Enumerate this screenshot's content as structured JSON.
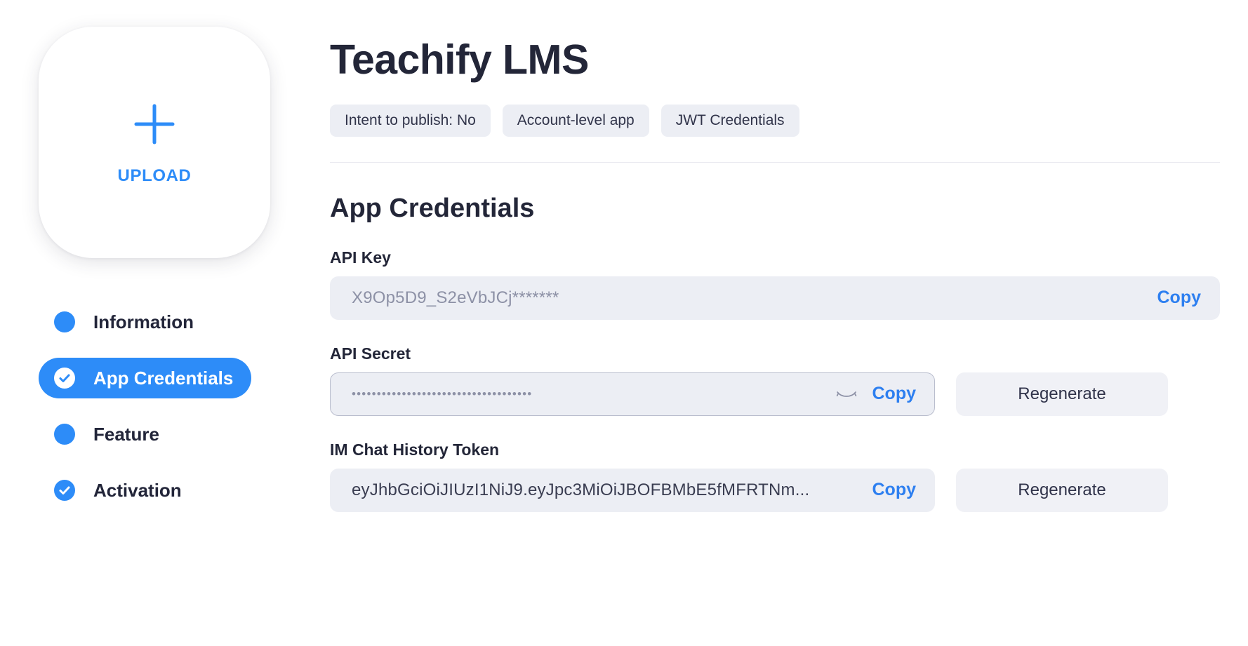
{
  "upload": {
    "label": "UPLOAD",
    "plus_icon": "plus-icon",
    "accent_color": "#2d8cf8"
  },
  "sidebar": {
    "items": [
      {
        "label": "Information",
        "marker": "dot-icon",
        "active": false
      },
      {
        "label": "App Credentials",
        "marker": "check-circle-icon",
        "active": true
      },
      {
        "label": "Feature",
        "marker": "dot-icon",
        "active": false
      },
      {
        "label": "Activation",
        "marker": "check-circle-icon",
        "active": false
      }
    ],
    "active_bg": "#2d8cf8"
  },
  "header": {
    "title": "Teachify LMS",
    "badges": [
      "Intent to publish: No",
      "Account-level app",
      "JWT Credentials"
    ]
  },
  "section": {
    "title": "App Credentials"
  },
  "fields": {
    "api_key": {
      "label": "API Key",
      "value": "X9Op5D9_S2eVbJCj*******",
      "copy_label": "Copy"
    },
    "api_secret": {
      "label": "API Secret",
      "value": "••••••••••••••••••••••••••••••••••••",
      "copy_label": "Copy",
      "regenerate_label": "Regenerate",
      "visibility_icon": "eye-off-icon"
    },
    "im_chat_history_token": {
      "label": "IM Chat History Token",
      "value": "eyJhbGciOiJIUzI1NiJ9.eyJpc3MiOiJBOFBMbE5fMFRTNm...",
      "copy_label": "Copy",
      "regenerate_label": "Regenerate"
    }
  },
  "colors": {
    "accent_blue": "#2d8cf8",
    "link_blue": "#2d7ff0",
    "field_bg": "#eceef4",
    "text_dark": "#232638"
  }
}
